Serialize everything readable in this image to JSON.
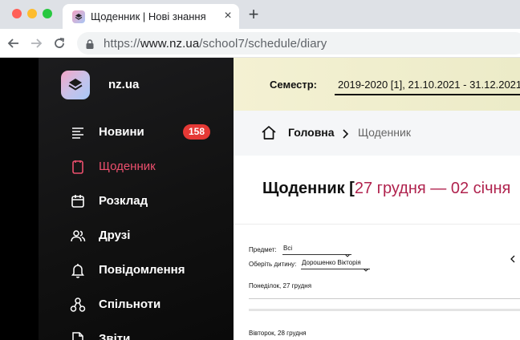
{
  "browser": {
    "tab_title": "Щоденник | Нові знання",
    "close_glyph": "×",
    "new_tab_glyph": "+",
    "url_scheme": "https://",
    "url_host": "www.nz.ua",
    "url_path": "/school7/schedule/diary"
  },
  "sidebar": {
    "brand": "nz.ua",
    "items": [
      {
        "label": "Новини",
        "icon": "news-lines-icon",
        "badge": "158"
      },
      {
        "label": "Щоденник",
        "icon": "diary-icon",
        "active": true
      },
      {
        "label": "Розклад",
        "icon": "calendar-icon"
      },
      {
        "label": "Друзі",
        "icon": "friends-icon"
      },
      {
        "label": "Повідомлення",
        "icon": "bell-icon"
      },
      {
        "label": "Спільноти",
        "icon": "communities-icon"
      },
      {
        "label": "Звіти",
        "icon": "reports-icon"
      }
    ]
  },
  "semester": {
    "label": "Семестр:",
    "value": "2019-2020 [1], 21.10.2021 - 31.12.2021"
  },
  "breadcrumb": {
    "home": "Головна",
    "current": "Щоденник"
  },
  "heading": {
    "title": "Щоденник [",
    "range": "27 грудня — 02 січня"
  },
  "filters": {
    "subject_label": "Предмет:",
    "subject_value": "Всі",
    "child_label": "Оберіть дитину:",
    "child_value": "Дорошенко Вікторія"
  },
  "days": [
    {
      "title": "Понеділок, 27 грудня"
    },
    {
      "title": "Вівторок, 28 грудня"
    }
  ],
  "colors": {
    "accent": "#ec4f6d",
    "badge": "#e53935",
    "range": "#b0234e",
    "semester_bg": "#f4f1d3"
  }
}
